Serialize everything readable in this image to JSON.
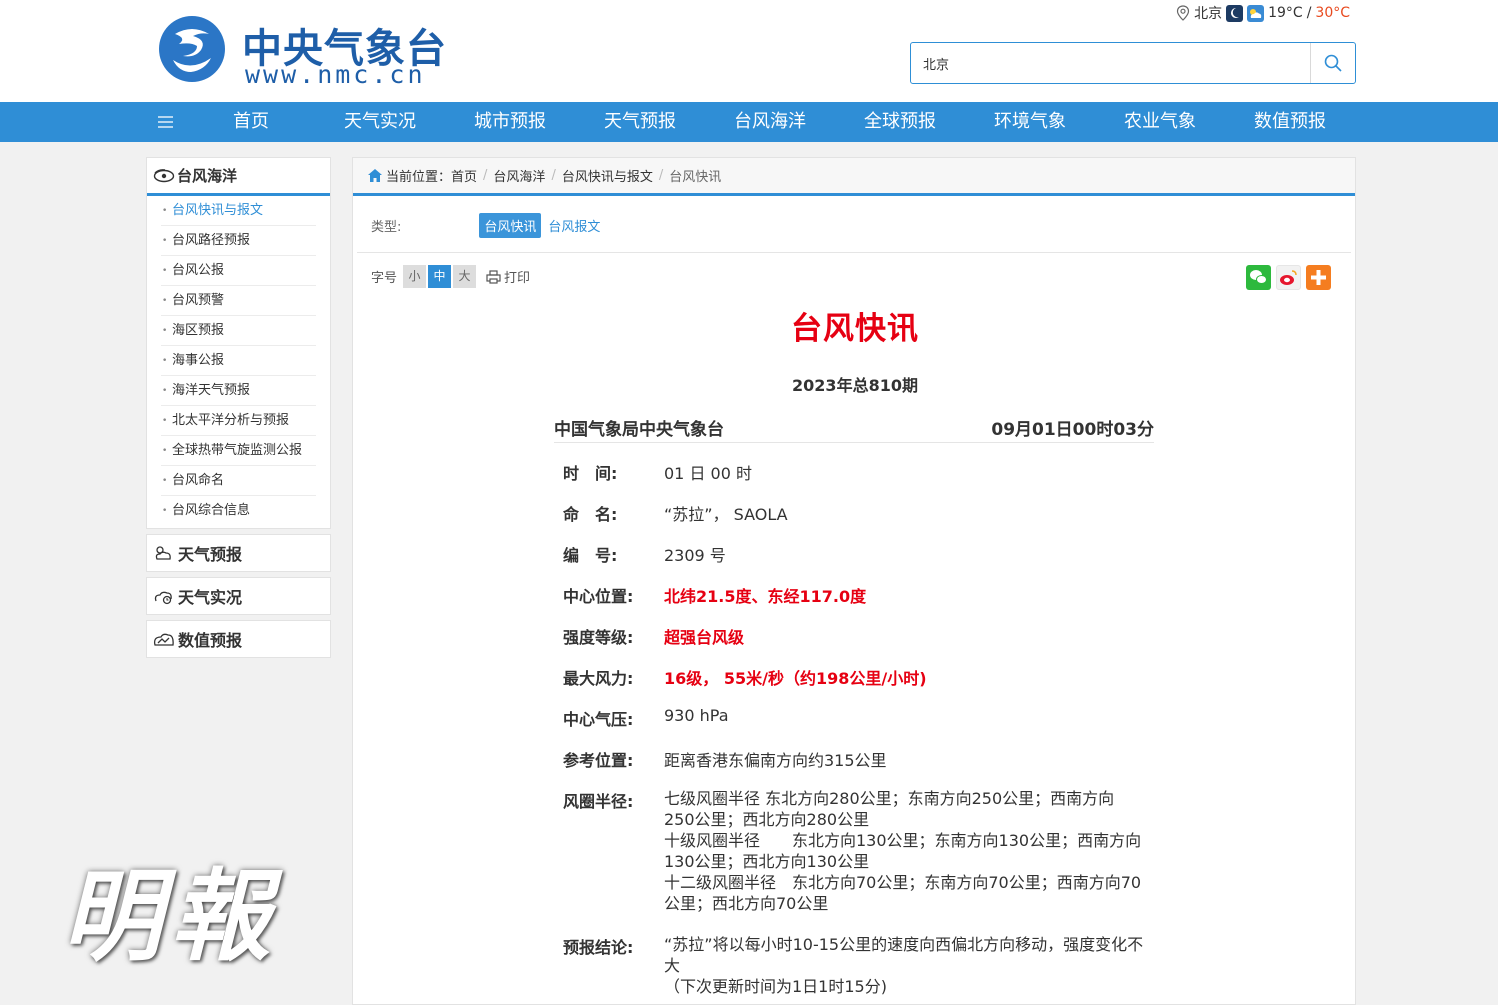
{
  "header": {
    "logo_cn": "中央气象台",
    "logo_en": "www.nmc.cn",
    "city": "北京",
    "temp_low": "19°C",
    "temp_sep": "/",
    "temp_high": "30°C",
    "search_value": "北京"
  },
  "nav": {
    "items": [
      "首页",
      "天气实况",
      "城市预报",
      "天气预报",
      "台风海洋",
      "全球预报",
      "环境气象",
      "农业气象",
      "数值预报"
    ]
  },
  "sidebar": {
    "section_title": "台风海洋",
    "items": [
      "台风快讯与报文",
      "台风路径预报",
      "台风公报",
      "台风预警",
      "海区预报",
      "海事公报",
      "海洋天气预报",
      "北太平洋分析与预报",
      "全球热带气旋监测公报",
      "台风命名",
      "台风综合信息"
    ],
    "active_index": 0,
    "categories": [
      "天气预报",
      "天气实况",
      "数值预报"
    ]
  },
  "breadcrumb": {
    "label": "当前位置：",
    "items": [
      "首页",
      "台风海洋",
      "台风快讯与报文",
      "台风快讯"
    ],
    "sep": "/"
  },
  "type_filter": {
    "label": "类型:",
    "options": [
      "台风快讯",
      "台风报文"
    ],
    "selected": "台风快讯"
  },
  "font_size": {
    "label": "字号",
    "options": [
      "小",
      "中",
      "大"
    ],
    "selected": "中",
    "print_label": "打印"
  },
  "article": {
    "title": "台风快讯",
    "issue": "2023年总810期",
    "agency": "中国气象局中央气象台",
    "issued_at": "09月01日00时03分",
    "fields": [
      {
        "key": "时　间:",
        "value": "01 日 00 时"
      },
      {
        "key": "命　名:",
        "value": "“苏拉”， SAOLA"
      },
      {
        "key": "编　号:",
        "value": "2309 号"
      },
      {
        "key": "中心位置:",
        "value": "北纬21.5度、东经117.0度"
      },
      {
        "key": "强度等级:",
        "value": "超强台风级"
      },
      {
        "key": "最大风力:",
        "value": "16级， 55米/秒（约198公里/小时)"
      },
      {
        "key": "中心气压:",
        "value": "930 hPa"
      },
      {
        "key": "参考位置:",
        "value": "距离香港东偏南方向约315公里"
      },
      {
        "key": "风圈半径:",
        "lines": [
          "七级风圈半径 东北方向280公里；东南方向250公里；西南方向250公里；西北方向280公里",
          "十级风圈半径　　东北方向130公里；东南方向130公里；西南方向130公里；西北方向130公里",
          "十二级风圈半径　东北方向70公里；东南方向70公里；西南方向70公里；西北方向70公里"
        ]
      },
      {
        "key": "预报结论:",
        "lines": [
          "“苏拉”将以每小时10-15公里的速度向西偏北方向移动，强度变化不大",
          "（下次更新时间为1日1时15分)"
        ]
      }
    ]
  },
  "watermark": "明報",
  "colors": {
    "brand_blue": "#2f8ed6",
    "logo_blue": "#1e5ea8",
    "alert_red": "#e60012",
    "temp_high": "#e84a1f"
  }
}
